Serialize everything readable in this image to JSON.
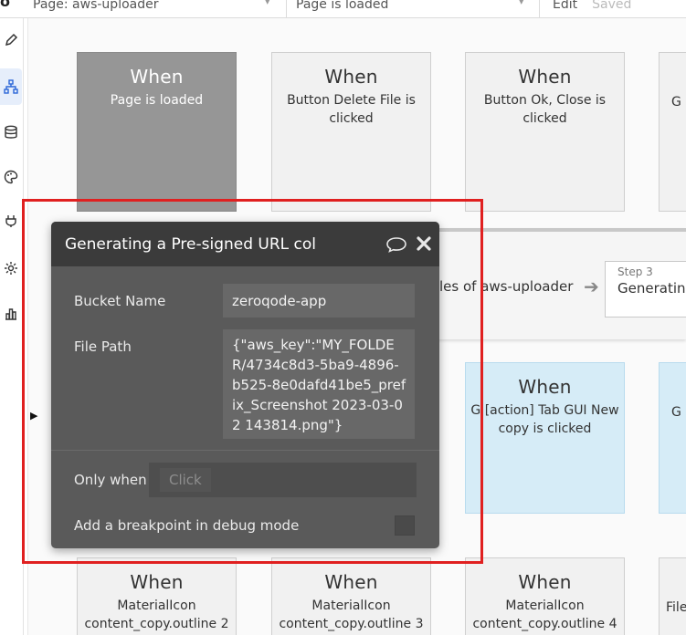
{
  "topbar": {
    "page_selector": "Page: aws-uploader",
    "event_selector": "Page is loaded",
    "edit_label": "Edit",
    "saved_label": "Saved"
  },
  "sidebar": {
    "items": [
      {
        "icon": "pencil-icon"
      },
      {
        "icon": "workflow-icon",
        "active": true
      },
      {
        "icon": "database-icon"
      },
      {
        "icon": "palette-icon"
      },
      {
        "icon": "plugin-icon"
      },
      {
        "icon": "gear-icon"
      },
      {
        "icon": "chart-icon"
      }
    ]
  },
  "events": {
    "row1": [
      {
        "when": "When",
        "desc": "Page is loaded"
      },
      {
        "when": "When",
        "desc": "Button Delete File is clicked"
      },
      {
        "when": "When",
        "desc": "Button Ok, Close is clicked"
      },
      {
        "when": "",
        "desc": "G ["
      }
    ],
    "row2": [
      {
        "when": "When",
        "desc": "G [action] Tab GUI New copy is clicked"
      },
      {
        "when": "",
        "desc": "G ["
      }
    ],
    "row3": [
      {
        "when": "When",
        "desc": "MaterialIcon content_copy.outline 2"
      },
      {
        "when": "When",
        "desc": "MaterialIcon content_copy.outline 3"
      },
      {
        "when": "When",
        "desc": "MaterialIcon content_copy.outline 4"
      },
      {
        "when": "",
        "desc": "File"
      }
    ]
  },
  "workflow_strip": {
    "step2_text": "les of aws-uploader",
    "step3_number": "Step 3",
    "step3_title": "Generating"
  },
  "panel": {
    "title": "Generating a Pre-signed URL col",
    "bucket_label": "Bucket Name",
    "bucket_value": "zeroqode-app",
    "path_label": "File Path",
    "path_value": "{\"aws_key\":\"MY_FOLDER/4734c8d3-5ba9-4896-b525-8e0dafd41be5_prefix_Screenshot 2023-03-02 143814.png\"}",
    "only_when_label": "Only when",
    "only_when_placeholder": "Click",
    "breakpoint_label": "Add a breakpoint in debug mode",
    "breakpoint_checked": false
  }
}
